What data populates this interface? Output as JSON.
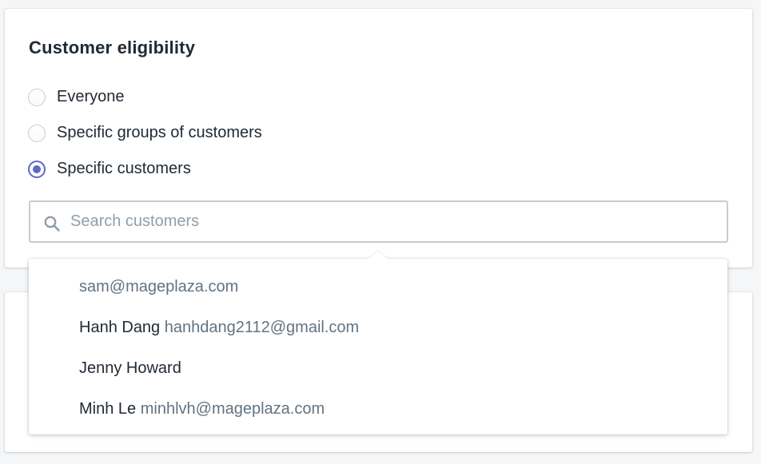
{
  "section": {
    "title": "Customer eligibility"
  },
  "eligibility": {
    "options": [
      {
        "label": "Everyone",
        "checked": false
      },
      {
        "label": "Specific groups of customers",
        "checked": false
      },
      {
        "label": "Specific customers",
        "checked": true
      }
    ]
  },
  "search": {
    "placeholder": "Search customers",
    "value": "",
    "icon": "search-icon"
  },
  "results": [
    {
      "name": "",
      "email": "sam@mageplaza.com"
    },
    {
      "name": "Hanh Dang",
      "email": "hanhdang2112@gmail.com"
    },
    {
      "name": "Jenny Howard",
      "email": ""
    },
    {
      "name": "Minh Le",
      "email": "minhlvh@mageplaza.com"
    }
  ],
  "colors": {
    "accent": "#5c6ac4",
    "text": "#212b36",
    "subdued": "#637381",
    "border": "#c4cdd5",
    "background": "#f4f6f8"
  }
}
